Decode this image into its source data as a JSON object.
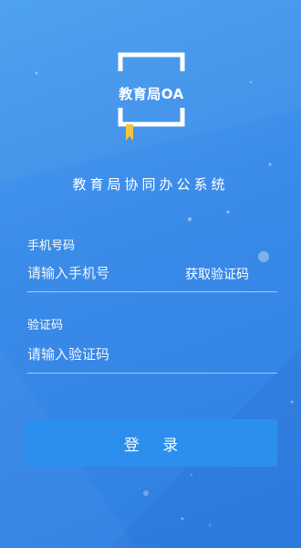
{
  "logo": {
    "title": "教育局OA"
  },
  "app": {
    "subtitle": "教育局协同办公系统"
  },
  "phone": {
    "label": "手机号码",
    "placeholder": "请输入手机号",
    "get_code_label": "获取验证码"
  },
  "code": {
    "label": "验证码",
    "placeholder": "请输入验证码"
  },
  "login": {
    "button_label": "登 录"
  },
  "colors": {
    "background": "#3a8ae8",
    "button": "#2c8eed",
    "text": "#ffffff"
  }
}
